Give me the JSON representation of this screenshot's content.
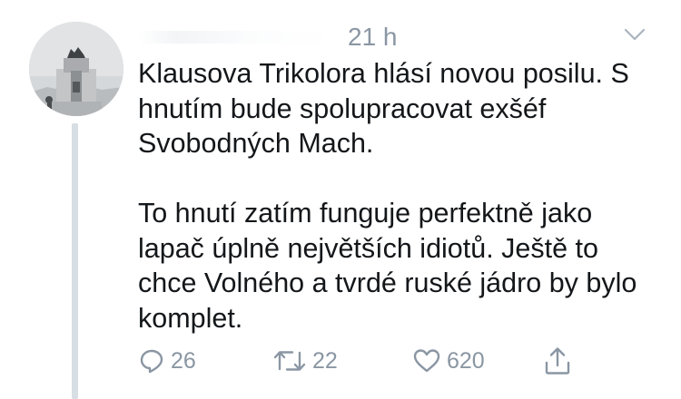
{
  "tweet": {
    "timestamp": "21 h",
    "text": "Klausova Trikolora hlásí novou posilu. S hnutím bude spolupracovat exšéf Svobodných Mach.\n\nTo hnutí zatím funguje perfektně jako lapač úplně největších idiotů. Ještě to chce Volného a tvrdé ruské jádro by bylo komplet."
  },
  "actions": {
    "reply_count": "26",
    "retweet_count": "22",
    "like_count": "620"
  },
  "icons": {
    "reply": "reply-icon",
    "retweet": "retweet-icon",
    "like": "heart-icon",
    "share": "share-icon",
    "caret": "chevron-down-icon"
  },
  "colors": {
    "text": "#14171a",
    "muted": "#8a96a3",
    "thread_line": "#d7dfe5"
  }
}
